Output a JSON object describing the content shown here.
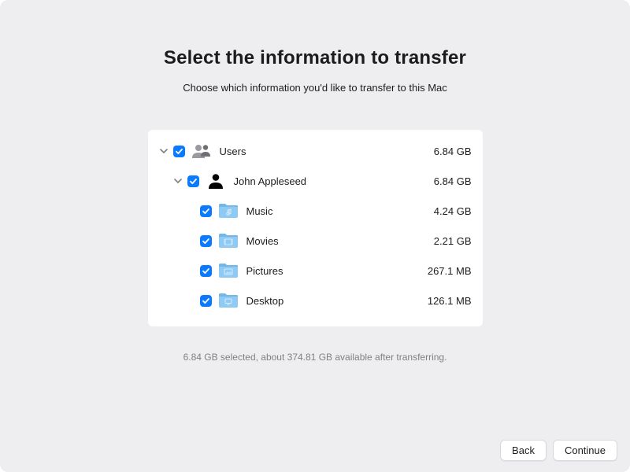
{
  "heading": "Select the information to transfer",
  "subtitle": "Choose which information you'd like to transfer to this Mac",
  "tree": {
    "users": {
      "label": "Users",
      "size": "6.84 GB"
    },
    "user0": {
      "label": "John Appleseed",
      "size": "6.84 GB"
    },
    "items": [
      {
        "label": "Music",
        "size": "4.24 GB"
      },
      {
        "label": "Movies",
        "size": "2.21 GB"
      },
      {
        "label": "Pictures",
        "size": "267.1 MB"
      },
      {
        "label": "Desktop",
        "size": "126.1 MB"
      }
    ]
  },
  "status": "6.84 GB selected, about 374.81 GB available after transferring.",
  "footer": {
    "back": "Back",
    "continue": "Continue"
  },
  "colors": {
    "accent": "#0a7aff",
    "folder": "#85c4f2",
    "folderTop": "#6fb3e8"
  }
}
